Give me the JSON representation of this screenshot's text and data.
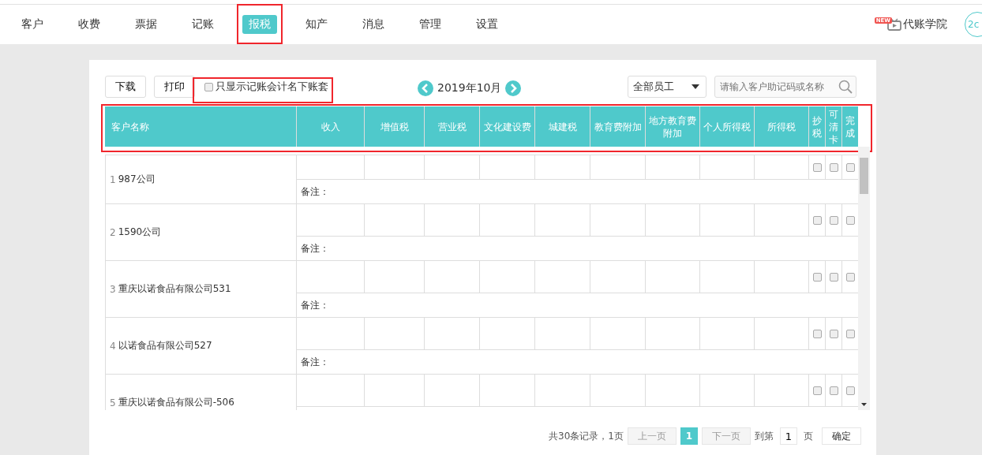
{
  "nav": {
    "items": [
      {
        "label": "客户",
        "selected": false
      },
      {
        "label": "收费",
        "selected": false
      },
      {
        "label": "票据",
        "selected": false
      },
      {
        "label": "记账",
        "selected": false
      },
      {
        "label": "报税",
        "selected": true
      },
      {
        "label": "知产",
        "selected": false
      },
      {
        "label": "消息",
        "selected": false
      },
      {
        "label": "管理",
        "selected": false
      },
      {
        "label": "设置",
        "selected": false
      }
    ],
    "badge": "NEW",
    "academy": "代账学院",
    "avatar": "2c"
  },
  "toolbar": {
    "download": "下载",
    "print": "打印",
    "filter": {
      "label": "只显示记账会计名下账套",
      "checked": false
    },
    "period": "2019年10月",
    "staff": "全部员工",
    "search": {
      "placeholder": "请输入客户助记码或名称"
    }
  },
  "table": {
    "columns": [
      "客户名称",
      "收入",
      "增值税",
      "营业税",
      "文化建设费",
      "城建税",
      "教育费附加",
      "地方教育费附加",
      "个人所得税",
      "所得税",
      "抄税",
      "可清卡",
      "完成"
    ],
    "rows": [
      {
        "index": "1",
        "name": "987公司",
        "remark": "备注：",
        "checks": [
          {
            "checked": false
          },
          {
            "checked": false
          },
          {
            "checked": false
          }
        ]
      },
      {
        "index": "2",
        "name": "1590公司",
        "remark": "备注：",
        "checks": [
          {
            "checked": false
          },
          {
            "checked": false
          },
          {
            "checked": false
          }
        ]
      },
      {
        "index": "3",
        "name": "重庆以诺食品有限公司531",
        "remark": "备注：",
        "checks": [
          {
            "checked": false
          },
          {
            "checked": false
          },
          {
            "checked": false
          }
        ]
      },
      {
        "index": "4",
        "name": "以诺食品有限公司527",
        "remark": "备注：",
        "checks": [
          {
            "checked": false
          },
          {
            "checked": false
          },
          {
            "checked": false
          }
        ]
      },
      {
        "index": "5",
        "name": "重庆以诺食品有限公司-506",
        "checks": [
          {
            "checked": false
          },
          {
            "checked": false
          },
          {
            "checked": false
          }
        ]
      }
    ]
  },
  "pagination": {
    "summary": "共30条记录，1页",
    "prev": {
      "label": "上一页",
      "disabled": true
    },
    "pages": [
      {
        "label": "1",
        "selected": true
      }
    ],
    "next": {
      "label": "下一页",
      "disabled": true
    },
    "goto": "到第",
    "page_input": "1",
    "unit": "页",
    "confirm": "确定"
  }
}
